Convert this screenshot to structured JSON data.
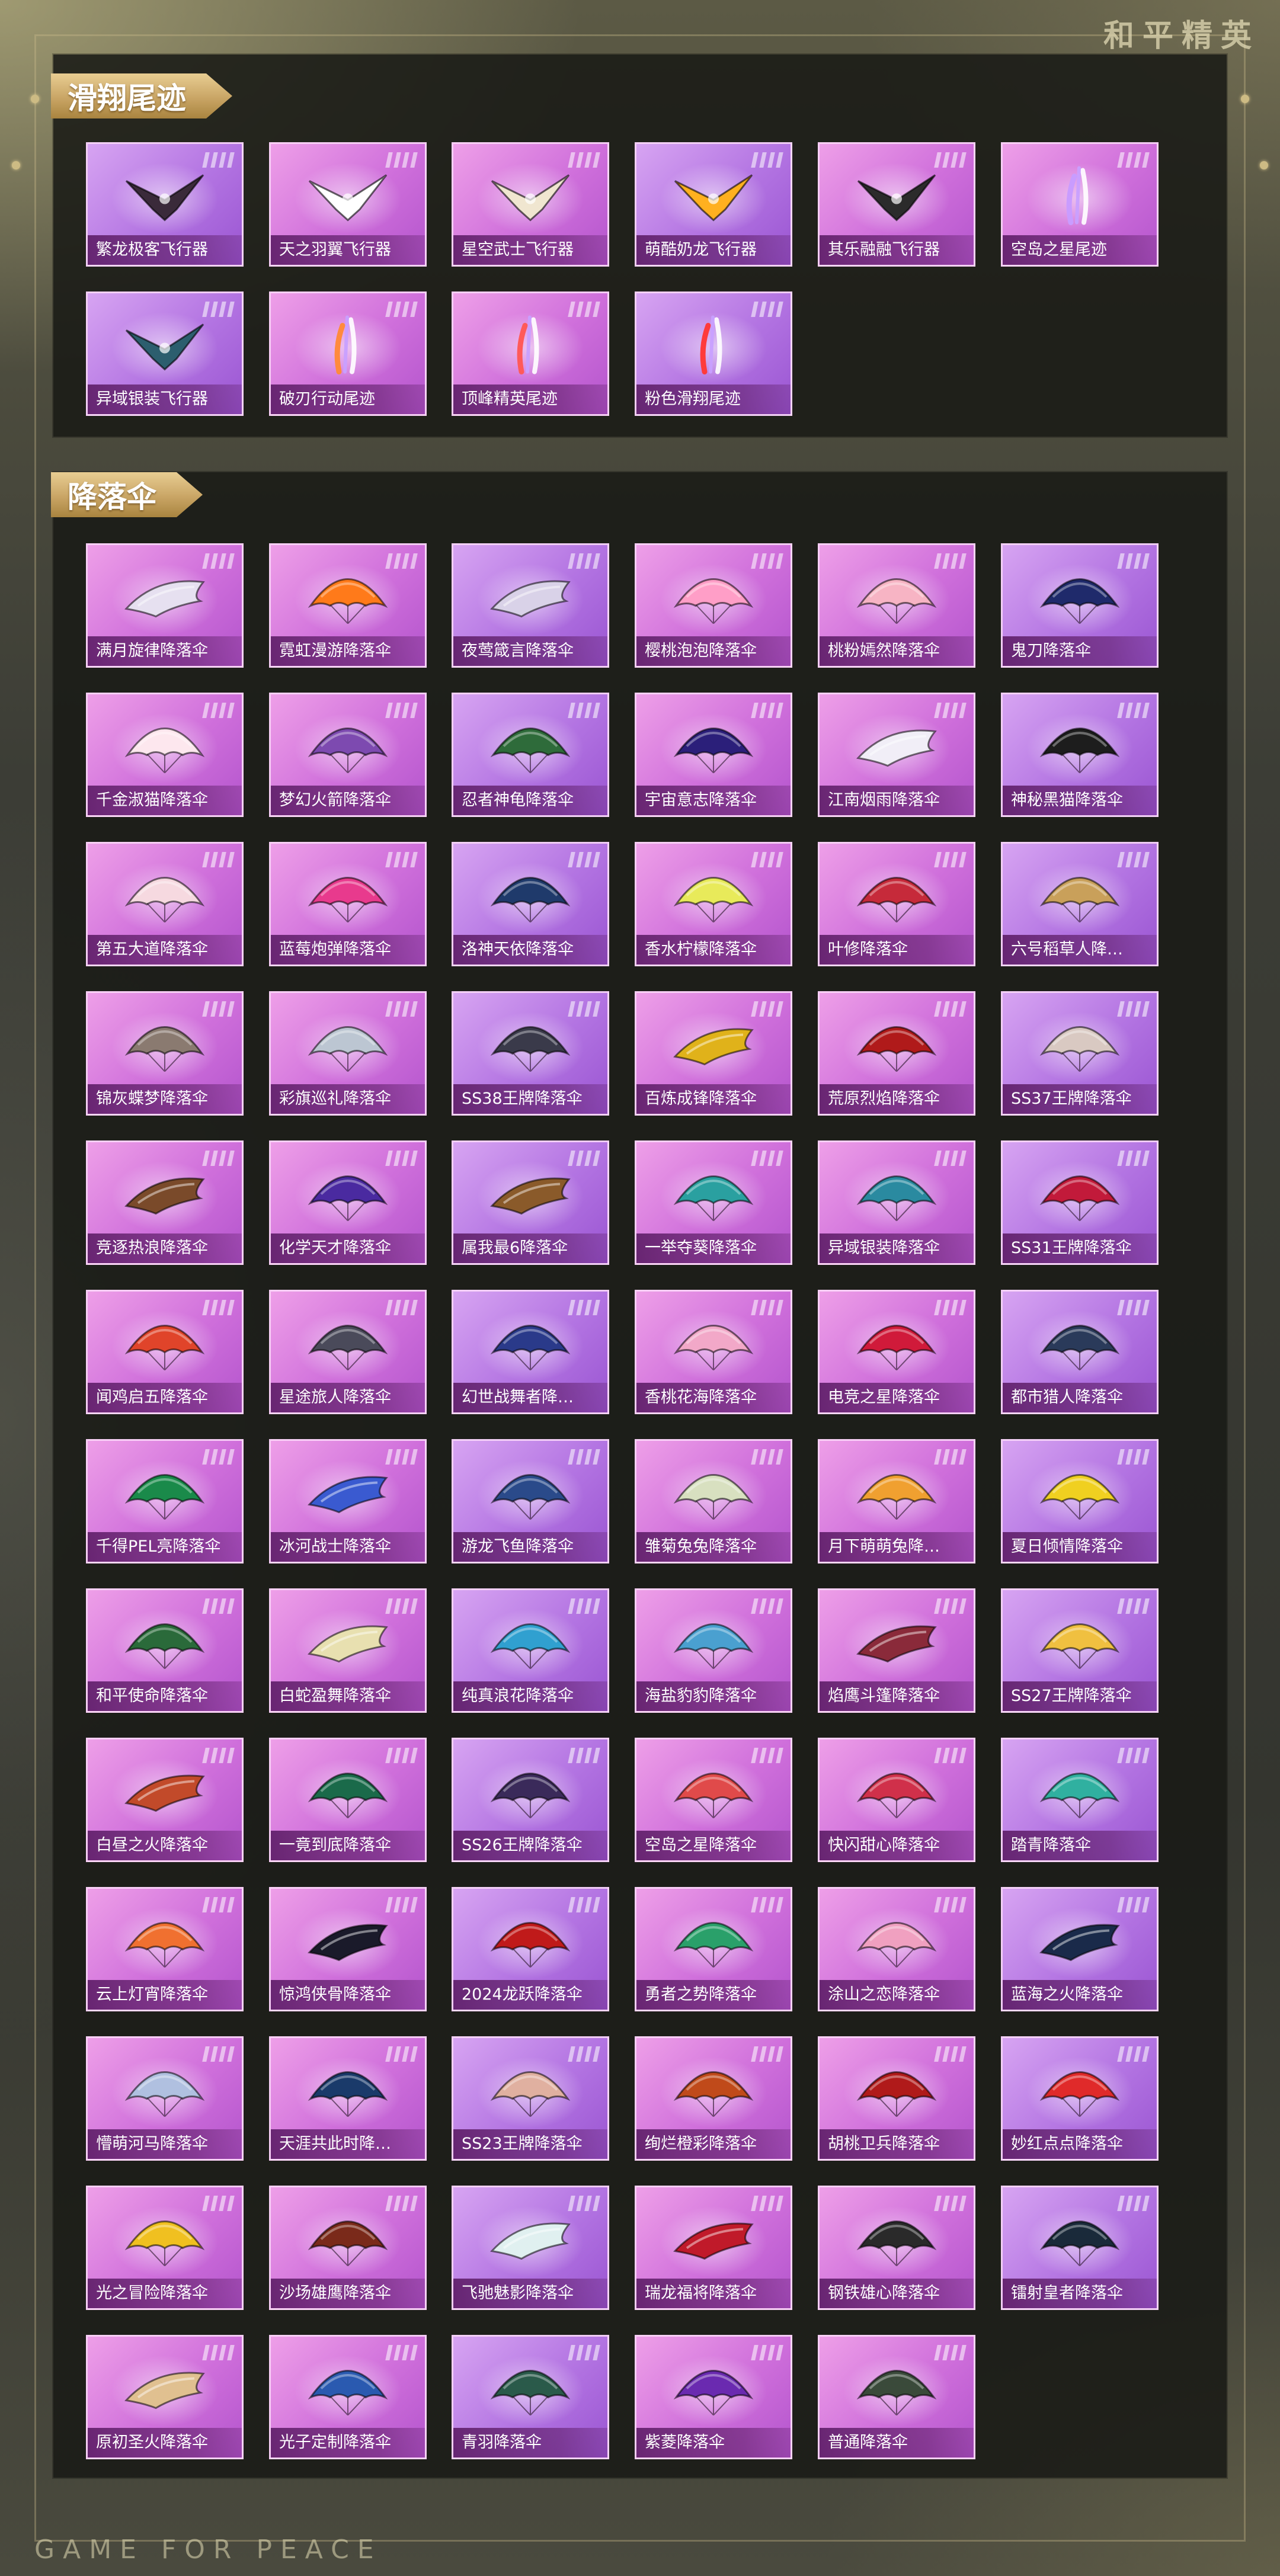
{
  "brand": {
    "logo": "和平精英",
    "footer": "GAME FOR PEACE"
  },
  "sections": [
    {
      "title": "滑翔尾迹",
      "items": [
        {
          "name": "繁龙极客飞行器",
          "icon": "glider-icon",
          "color": "#3a2a3a"
        },
        {
          "name": "天之羽翼飞行器",
          "icon": "glider-icon",
          "color": "#ffffff"
        },
        {
          "name": "星空武士飞行器",
          "icon": "glider-icon",
          "color": "#f0e6d0"
        },
        {
          "name": "萌酷奶龙飞行器",
          "icon": "glider-icon",
          "color": "#ffb01f"
        },
        {
          "name": "其乐融融飞行器",
          "icon": "glider-icon",
          "color": "#2b2b2b"
        },
        {
          "name": "空岛之星尾迹",
          "icon": "trail-icon",
          "color": "#c99cff"
        },
        {
          "name": "异域银装飞行器",
          "icon": "glider-icon",
          "color": "#2c5e6e"
        },
        {
          "name": "破刃行动尾迹",
          "icon": "trail-icon",
          "color": "#ff8a3d"
        },
        {
          "name": "顶峰精英尾迹",
          "icon": "trail-icon",
          "color": "#ff5a5a"
        },
        {
          "name": "粉色滑翔尾迹",
          "icon": "trail-icon",
          "color": "#ff3b3b"
        }
      ]
    },
    {
      "title": "降落伞",
      "items": [
        {
          "name": "满月旋律降落伞",
          "icon": "wing-icon",
          "color": "#e6e0f0"
        },
        {
          "name": "霓虹漫游降落伞",
          "icon": "parachute-icon",
          "color": "#ff7a1a"
        },
        {
          "name": "夜莺箴言降落伞",
          "icon": "wing-icon",
          "color": "#d9d2e8"
        },
        {
          "name": "樱桃泡泡降落伞",
          "icon": "parachute-icon",
          "color": "#ff9ec7"
        },
        {
          "name": "桃粉嫣然降落伞",
          "icon": "parachute-icon",
          "color": "#f7b4c4"
        },
        {
          "name": "鬼刀降落伞",
          "icon": "parachute-icon",
          "color": "#1f2a6b"
        },
        {
          "name": "千金淑猫降落伞",
          "icon": "parachute-icon",
          "color": "#fde7ee"
        },
        {
          "name": "梦幻火箭降落伞",
          "icon": "parachute-icon",
          "color": "#7d4ab0"
        },
        {
          "name": "忍者神龟降落伞",
          "icon": "parachute-icon",
          "color": "#2e6b3a"
        },
        {
          "name": "宇宙意志降落伞",
          "icon": "parachute-icon",
          "color": "#2b1f7a"
        },
        {
          "name": "江南烟雨降落伞",
          "icon": "wing-icon",
          "color": "#f1eef7"
        },
        {
          "name": "神秘黑猫降落伞",
          "icon": "parachute-icon",
          "color": "#1d1d1d"
        },
        {
          "name": "第五大道降落伞",
          "icon": "parachute-icon",
          "color": "#f6d9e0"
        },
        {
          "name": "蓝莓炮弹降落伞",
          "icon": "parachute-icon",
          "color": "#e83a8d"
        },
        {
          "name": "洛神天依降落伞",
          "icon": "parachute-icon",
          "color": "#1f3a6b"
        },
        {
          "name": "香水柠檬降落伞",
          "icon": "parachute-icon",
          "color": "#e8ea5a"
        },
        {
          "name": "叶修降落伞",
          "icon": "parachute-icon",
          "color": "#c62a3a"
        },
        {
          "name": "六号稻草人降…",
          "icon": "parachute-icon",
          "color": "#c9a05a"
        },
        {
          "name": "锦灰蝶梦降落伞",
          "icon": "parachute-icon",
          "color": "#8a7a70"
        },
        {
          "name": "彩旗巡礼降落伞",
          "icon": "parachute-icon",
          "color": "#bcc6d2"
        },
        {
          "name": "SS38王牌降落伞",
          "icon": "parachute-icon",
          "color": "#3a3a4a"
        },
        {
          "name": "百炼成锋降落伞",
          "icon": "wing-icon",
          "color": "#e0b21a"
        },
        {
          "name": "荒原烈焰降落伞",
          "icon": "parachute-icon",
          "color": "#b01a1a"
        },
        {
          "name": "SS37王牌降落伞",
          "icon": "parachute-icon",
          "color": "#d9c9c2"
        },
        {
          "name": "竞逐热浪降落伞",
          "icon": "wing-icon",
          "color": "#7a4a2a"
        },
        {
          "name": "化学天才降落伞",
          "icon": "parachute-icon",
          "color": "#4a2aa0"
        },
        {
          "name": "属我最6降落伞",
          "icon": "wing-icon",
          "color": "#8a5a2a"
        },
        {
          "name": "一举夺葵降落伞",
          "icon": "parachute-icon",
          "color": "#2aa0a0"
        },
        {
          "name": "异域银装降落伞",
          "icon": "parachute-icon",
          "color": "#2a8aa0"
        },
        {
          "name": "SS31王牌降落伞",
          "icon": "parachute-icon",
          "color": "#c21a3a"
        },
        {
          "name": "闻鸡启五降落伞",
          "icon": "parachute-icon",
          "color": "#e0442a"
        },
        {
          "name": "星途旅人降落伞",
          "icon": "parachute-icon",
          "color": "#4a4a5a"
        },
        {
          "name": "幻世战舞者降…",
          "icon": "parachute-icon",
          "color": "#2a3a8a"
        },
        {
          "name": "香桃花海降落伞",
          "icon": "parachute-icon",
          "color": "#f2a8c8"
        },
        {
          "name": "电竞之星降落伞",
          "icon": "parachute-icon",
          "color": "#d01a3a"
        },
        {
          "name": "都市猎人降落伞",
          "icon": "parachute-icon",
          "color": "#2a3a5a"
        },
        {
          "name": "千得PEL亮降落伞",
          "icon": "parachute-icon",
          "color": "#1a8a4a"
        },
        {
          "name": "冰河战士降落伞",
          "icon": "wing-icon",
          "color": "#3a5ad0"
        },
        {
          "name": "游龙飞鱼降落伞",
          "icon": "parachute-icon",
          "color": "#2a4a8a"
        },
        {
          "name": "雏菊兔兔降落伞",
          "icon": "parachute-icon",
          "color": "#d8e0c0"
        },
        {
          "name": "月下萌萌兔降…",
          "icon": "parachute-icon",
          "color": "#f0a030"
        },
        {
          "name": "夏日倾情降落伞",
          "icon": "parachute-icon",
          "color": "#f0d020"
        },
        {
          "name": "和平使命降落伞",
          "icon": "parachute-icon",
          "color": "#2a6a3a"
        },
        {
          "name": "白蛇盈舞降落伞",
          "icon": "wing-icon",
          "color": "#e8e0b0"
        },
        {
          "name": "纯真浪花降落伞",
          "icon": "parachute-icon",
          "color": "#30a0d0"
        },
        {
          "name": "海盐豹豹降落伞",
          "icon": "parachute-icon",
          "color": "#4aa0d0"
        },
        {
          "name": "焰鹰斗篷降落伞",
          "icon": "wing-icon",
          "color": "#8a2a3a"
        },
        {
          "name": "SS27王牌降落伞",
          "icon": "parachute-icon",
          "color": "#f0c040"
        },
        {
          "name": "白昼之火降落伞",
          "icon": "wing-icon",
          "color": "#c24a2a"
        },
        {
          "name": "一竟到底降落伞",
          "icon": "parachute-icon",
          "color": "#1a6a4a"
        },
        {
          "name": "SS26王牌降落伞",
          "icon": "parachute-icon",
          "color": "#3a2a5a"
        },
        {
          "name": "空岛之星降落伞",
          "icon": "parachute-icon",
          "color": "#e04a4a"
        },
        {
          "name": "快闪甜心降落伞",
          "icon": "parachute-icon",
          "color": "#d0304a"
        },
        {
          "name": "踏青降落伞",
          "icon": "parachute-icon",
          "color": "#30b0a0"
        },
        {
          "name": "云上灯宵降落伞",
          "icon": "parachute-icon",
          "color": "#f07030"
        },
        {
          "name": "惊鸿侠骨降落伞",
          "icon": "wing-icon",
          "color": "#1a1a2a"
        },
        {
          "name": "2024龙跃降落伞",
          "icon": "parachute-icon",
          "color": "#c01a1a"
        },
        {
          "name": "勇者之势降落伞",
          "icon": "parachute-icon",
          "color": "#2aa06a"
        },
        {
          "name": "涂山之恋降落伞",
          "icon": "parachute-icon",
          "color": "#f0a0c0"
        },
        {
          "name": "蓝海之火降落伞",
          "icon": "wing-icon",
          "color": "#1a2a4a"
        },
        {
          "name": "懵萌河马降落伞",
          "icon": "parachute-icon",
          "color": "#b0c0e0"
        },
        {
          "name": "天涯共此时降…",
          "icon": "parachute-icon",
          "color": "#1a3a6a"
        },
        {
          "name": "SS23王牌降落伞",
          "icon": "parachute-icon",
          "color": "#e0b0a0"
        },
        {
          "name": "绚烂橙彩降落伞",
          "icon": "parachute-icon",
          "color": "#c04a1a"
        },
        {
          "name": "胡桃卫兵降落伞",
          "icon": "parachute-icon",
          "color": "#b01a1a"
        },
        {
          "name": "妙红点点降落伞",
          "icon": "parachute-icon",
          "color": "#e02a2a"
        },
        {
          "name": "光之冒险降落伞",
          "icon": "parachute-icon",
          "color": "#f0c020"
        },
        {
          "name": "沙场雄鹰降落伞",
          "icon": "parachute-icon",
          "color": "#7a2a1a"
        },
        {
          "name": "飞驰魅影降落伞",
          "icon": "wing-icon",
          "color": "#e0f0f0"
        },
        {
          "name": "瑞龙福将降落伞",
          "icon": "wing-icon",
          "color": "#c01a2a"
        },
        {
          "name": "钢铁雄心降落伞",
          "icon": "parachute-icon",
          "color": "#2a2a2a"
        },
        {
          "name": "镭射皇者降落伞",
          "icon": "parachute-icon",
          "color": "#1a2a3a"
        },
        {
          "name": "原初圣火降落伞",
          "icon": "wing-icon",
          "color": "#e0c090"
        },
        {
          "name": "光子定制降落伞",
          "icon": "parachute-icon",
          "color": "#2a5ab0"
        },
        {
          "name": "青羽降落伞",
          "icon": "parachute-icon",
          "color": "#2a5a4a"
        },
        {
          "name": "紫菱降落伞",
          "icon": "parachute-icon",
          "color": "#6a2ab0"
        },
        {
          "name": "普通降落伞",
          "icon": "parachute-icon",
          "color": "#3a4a3a"
        }
      ]
    }
  ]
}
